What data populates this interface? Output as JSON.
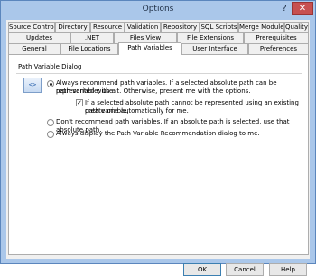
{
  "window": {
    "title": "Options",
    "help_glyph": "?",
    "close_glyph": "✕"
  },
  "tabs": {
    "row1": [
      "Source Control",
      "Directory",
      "Resource",
      "Validation",
      "Repository",
      "SQL Scripts",
      "Merge Modules",
      "Quality"
    ],
    "row2": [
      "Updates",
      ".NET",
      "Files View",
      "File Extensions",
      "Prerequisites"
    ],
    "row3": [
      "General",
      "File Locations",
      "Path Variables",
      "User Interface",
      "Preferences"
    ],
    "active": "Path Variables"
  },
  "group": {
    "title": "Path Variable Dialog"
  },
  "icon_glyph": "<>",
  "options": {
    "recommend": {
      "label_line1": "Always recommend path variables. If a selected absolute path can be represented with a",
      "label_line2": "path variable, use it. Otherwise, present me with the options.",
      "checked": true
    },
    "create_auto": {
      "label_line1": "If a selected absolute path cannot be represented using an existing path variable,",
      "label_line2": "create one automatically for me.",
      "checked": true
    },
    "dont_recommend": {
      "label": "Don't recommend path variables. If an absolute path is selected, use that absolute path.",
      "checked": false
    },
    "always_display": {
      "label": "Always display the Path Variable Recommendation dialog to me.",
      "checked": false
    }
  },
  "buttons": {
    "ok": "OK",
    "cancel": "Cancel",
    "help": "Help"
  }
}
